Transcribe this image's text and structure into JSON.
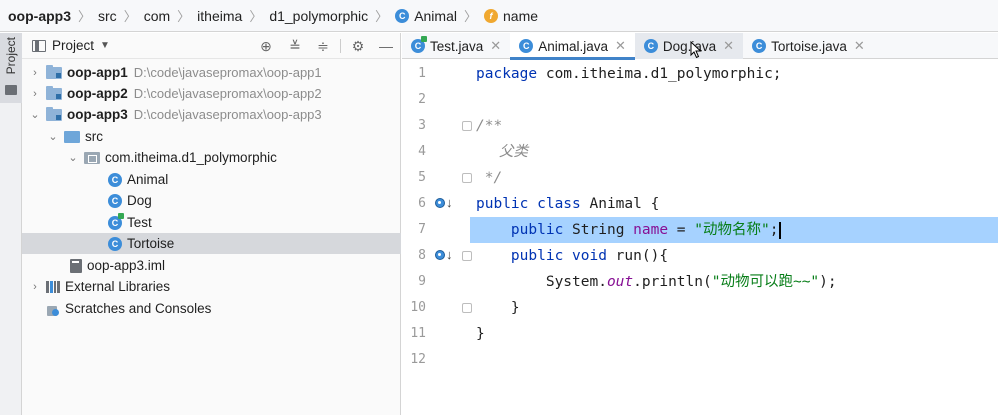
{
  "breadcrumb": {
    "project": "oop-app3",
    "items": [
      "src",
      "com",
      "itheima",
      "d1_polymorphic"
    ],
    "class_name": "Animal",
    "field_name": "name",
    "class_icon_letter": "C",
    "field_icon_letter": "f"
  },
  "stripe": {
    "label": "Project"
  },
  "project_panel": {
    "title": "Project",
    "tree": [
      {
        "name": "oop-app1",
        "path": "D:\\code\\javasepromax\\oop-app1"
      },
      {
        "name": "oop-app2",
        "path": "D:\\code\\javasepromax\\oop-app2"
      },
      {
        "name": "oop-app3",
        "path": "D:\\code\\javasepromax\\oop-app3"
      },
      {
        "name": "src"
      },
      {
        "name": "com.itheima.d1_polymorphic"
      },
      {
        "name": "Animal"
      },
      {
        "name": "Dog"
      },
      {
        "name": "Test"
      },
      {
        "name": "Tortoise"
      },
      {
        "name": "oop-app3.iml"
      },
      {
        "name": "External Libraries"
      },
      {
        "name": "Scratches and Consoles"
      }
    ]
  },
  "tabs": [
    {
      "label": "Test.java",
      "icon": "C"
    },
    {
      "label": "Animal.java",
      "icon": "C"
    },
    {
      "label": "Dog.java",
      "icon": "C"
    },
    {
      "label": "Tortoise.java",
      "icon": "C"
    }
  ],
  "editor": {
    "line_numbers": [
      "1",
      "2",
      "3",
      "4",
      "5",
      "6",
      "7",
      "8",
      "9",
      "10",
      "11",
      "12"
    ],
    "code": {
      "l1_kw": "package",
      "l1_rest": " com.itheima.d1_polymorphic;",
      "l3": "/**",
      "l4": "     父类",
      "l5": " */",
      "l6_kw": "public class",
      "l6_rest": " Animal {",
      "l7_indent": "    ",
      "l7_kw": "public",
      "l7_type": " String ",
      "l7_field": "name",
      "l7_eq": " = ",
      "l7_str": "\"动物名称\"",
      "l7_end": ";",
      "l8_indent": "    ",
      "l8_kw": "public void",
      "l8_rest": " run(){",
      "l9_a": "        System.",
      "l9_out": "out",
      "l9_b": ".println(",
      "l9_str": "\"动物可以跑~~\"",
      "l9_c": ");",
      "l10": "    }",
      "l11": "}"
    }
  },
  "colors": {
    "accent": "#4083c9",
    "selection": "#a6d2ff",
    "keyword": "#0033b3",
    "string": "#067d17"
  }
}
